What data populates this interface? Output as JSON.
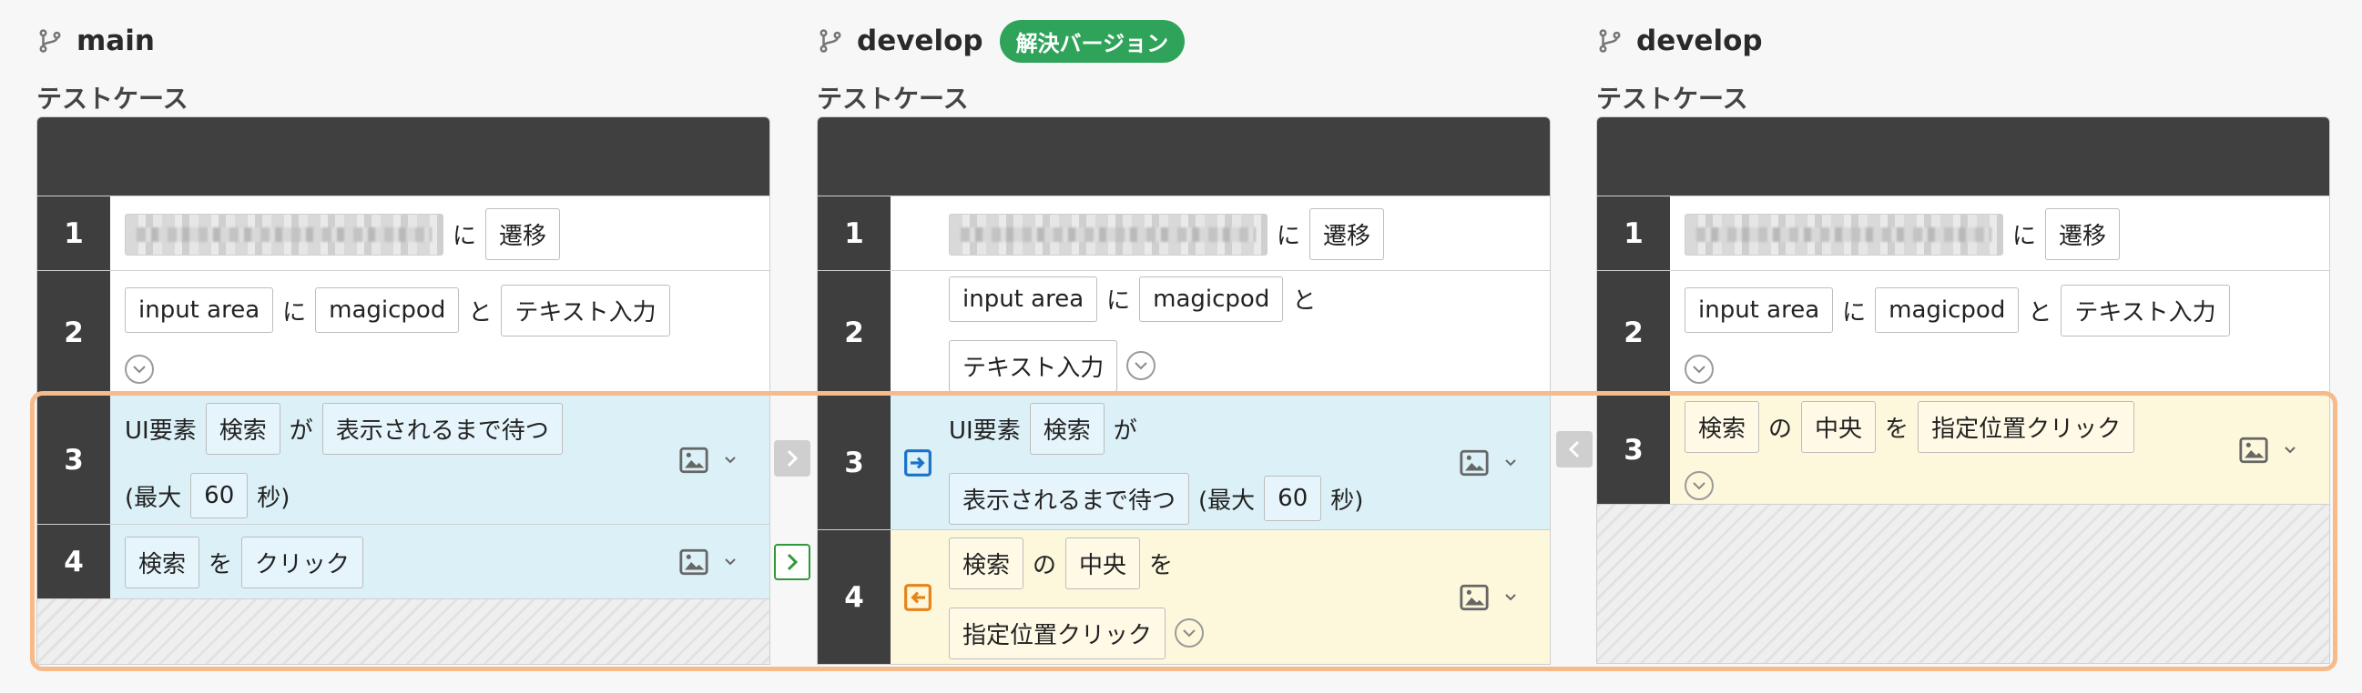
{
  "section_label": "テストケース",
  "panes": [
    {
      "branch": "main",
      "badge": "",
      "steps": [
        {
          "num": "1",
          "url_value": "",
          "particle1": "に",
          "action": "遷移"
        },
        {
          "num": "2",
          "target": "input area",
          "p1": "に",
          "value": "magicpod",
          "p2": "と",
          "action": "テキスト入力"
        },
        {
          "num": "3",
          "prefix": "UI要素",
          "target": "検索",
          "p1": "が",
          "action": "表示されるまで待つ",
          "open": "(最大",
          "timeout": "60",
          "close": "秒)"
        },
        {
          "num": "4",
          "target": "検索",
          "p1": "を",
          "action": "クリック"
        }
      ]
    },
    {
      "branch": "develop",
      "badge": "解決バージョン",
      "steps": [
        {
          "num": "1",
          "url_value": "",
          "particle1": "に",
          "action": "遷移"
        },
        {
          "num": "2",
          "target": "input area",
          "p1": "に",
          "value": "magicpod",
          "p2": "と",
          "action": "テキスト入力"
        },
        {
          "num": "3",
          "prefix": "UI要素",
          "target": "検索",
          "p1": "が",
          "action": "表示されるまで待つ",
          "open": "(最大",
          "timeout": "60",
          "close": "秒)"
        },
        {
          "num": "4",
          "target": "検索",
          "p1": "の",
          "position": "中央",
          "p2": "を",
          "action": "指定位置クリック"
        }
      ]
    },
    {
      "branch": "develop",
      "badge": "",
      "steps": [
        {
          "num": "1",
          "url_value": "",
          "particle1": "に",
          "action": "遷移"
        },
        {
          "num": "2",
          "target": "input area",
          "p1": "に",
          "value": "magicpod",
          "p2": "と",
          "action": "テキスト入力"
        },
        {
          "num": "3",
          "target": "検索",
          "p1": "の",
          "position": "中央",
          "p2": "を",
          "action": "指定位置クリック"
        }
      ]
    }
  ],
  "colors": {
    "added_row": "#dcf0f7",
    "changed_row": "#fdf7dc",
    "badge_green": "#2fa35a",
    "highlight_border": "#f6ba8b",
    "header_dark": "#404040"
  },
  "icons": [
    "branch-icon",
    "image-icon",
    "chevron-down-icon",
    "expand-circle-icon",
    "insert-right-icon",
    "insert-left-icon",
    "arrow-right-icon",
    "arrow-left-icon"
  ]
}
